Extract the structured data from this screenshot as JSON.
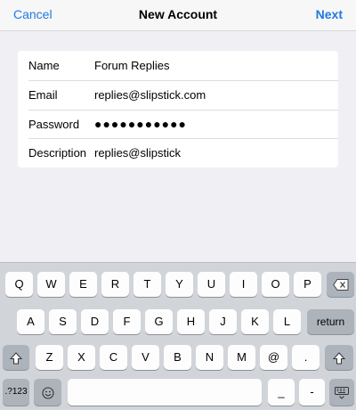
{
  "nav": {
    "cancel_label": "Cancel",
    "title": "New Account",
    "next_label": "Next"
  },
  "form": {
    "name_label": "Name",
    "name_value": "Forum Replies",
    "email_label": "Email",
    "email_value": "replies@slipstick.com",
    "password_label": "Password",
    "password_value": "●●●●●●●●●●●",
    "description_label": "Description",
    "description_value": "replies@slipstick"
  },
  "keyboard": {
    "row1": [
      "Q",
      "W",
      "E",
      "R",
      "T",
      "Y",
      "U",
      "I",
      "O",
      "P"
    ],
    "row2": [
      "A",
      "S",
      "D",
      "F",
      "G",
      "H",
      "J",
      "K",
      "L"
    ],
    "row3": [
      "Z",
      "X",
      "C",
      "V",
      "B",
      "N",
      "M",
      "@",
      "."
    ],
    "return_label": "return",
    "symbols_label": ".?123",
    "underscore_label": "_",
    "dash_label": "-"
  },
  "colors": {
    "accent": "#1f7ae0",
    "background": "#efeff4",
    "keyboard_bg": "#d1d4d9",
    "key_dark": "#adb3bb"
  }
}
